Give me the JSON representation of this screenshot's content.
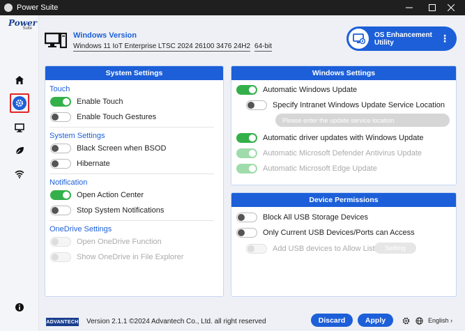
{
  "window": {
    "title": "Power Suite"
  },
  "logo": {
    "line1": "Power",
    "line2": "Suite"
  },
  "header": {
    "title": "Windows Version",
    "version": "Windows 11 IoT Enterprise LTSC 2024 26100 3476 24H2",
    "bits": "64-bit"
  },
  "enhancement": {
    "label": "OS Enhancement Utility",
    "menu": "⋮"
  },
  "system_settings": {
    "title": "System Settings",
    "sections": {
      "touch": "Touch",
      "system": "System Settings",
      "notification": "Notification",
      "onedrive": "OneDrive Settings"
    },
    "items": {
      "enable_touch": {
        "label": "Enable Touch",
        "state": "on"
      },
      "touch_gestures": {
        "label": "Enable Touch Gestures",
        "state": "off"
      },
      "black_screen": {
        "label": "Black Screen when BSOD",
        "state": "off"
      },
      "hibernate": {
        "label": "Hibernate",
        "state": "off"
      },
      "action_center": {
        "label": "Open Action Center",
        "state": "on"
      },
      "stop_notifications": {
        "label": "Stop System Notifications",
        "state": "off"
      },
      "onedrive_function": {
        "label": "Open OneDrive Function",
        "state": "disabled-off"
      },
      "onedrive_explorer": {
        "label": "Show OneDrive in File Explorer",
        "state": "disabled-off"
      }
    }
  },
  "windows_settings": {
    "title": "Windows Settings",
    "items": {
      "auto_update": {
        "label": "Automatic Windows Update",
        "state": "on"
      },
      "intranet": {
        "label": "Specify Intranet Windows Update Service Location",
        "state": "off"
      },
      "driver_updates": {
        "label": "Automatic driver updates with Windows Update",
        "state": "on"
      },
      "defender": {
        "label": "Automatic Microsoft Defender Antivirus Update",
        "state": "disabled-on"
      },
      "edge": {
        "label": "Automatic Microsoft Edge Update",
        "state": "disabled-on"
      }
    },
    "service_placeholder": "Please enter the update service location"
  },
  "device_permissions": {
    "title": "Device Permissions",
    "items": {
      "block_usb": {
        "label": "Block All USB Storage Devices",
        "state": "off"
      },
      "current_usb": {
        "label": "Only Current USB Devices/Ports can Access",
        "state": "off"
      },
      "add_usb": {
        "label": "Add USB devices to Allow List",
        "state": "disabled-off"
      }
    },
    "setting_label": "Setting"
  },
  "footer": {
    "brand": "ADVANTECH",
    "text": "Version 2.1.1 ©2024 Advantech Co., Ltd. all right reserved",
    "discard": "Discard",
    "apply": "Apply",
    "language": "English ›"
  }
}
